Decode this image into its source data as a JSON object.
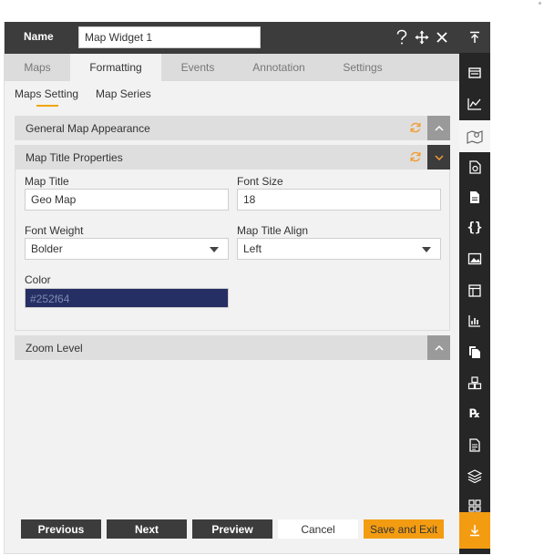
{
  "header": {
    "name_label": "Name",
    "name_value": "Map Widget 1",
    "help_icon": "question-icon",
    "move_icon": "move-icon",
    "close_icon": "close-icon"
  },
  "tabs": [
    {
      "label": "Maps"
    },
    {
      "label": "Formatting"
    },
    {
      "label": "Events"
    },
    {
      "label": "Annotation"
    },
    {
      "label": "Settings"
    }
  ],
  "active_tab": "Formatting",
  "subtabs": [
    {
      "label": "Maps Setting"
    },
    {
      "label": "Map Series"
    }
  ],
  "sections": {
    "general": {
      "title": "General Map Appearance"
    },
    "title_props": {
      "title": "Map Title Properties"
    },
    "zoom": {
      "title": "Zoom Level"
    }
  },
  "fields": {
    "map_title": {
      "label": "Map Title",
      "value": "Geo Map"
    },
    "font_size": {
      "label": "Font Size",
      "value": "18"
    },
    "font_weight": {
      "label": "Font Weight",
      "value": "Bolder"
    },
    "title_align": {
      "label": "Map Title Align",
      "value": "Left"
    },
    "color": {
      "label": "Color",
      "value": "#252f64"
    }
  },
  "footer": {
    "previous": "Previous",
    "next": "Next",
    "preview": "Preview",
    "cancel": "Cancel",
    "save_exit": "Save and Exit"
  },
  "colors": {
    "header_bg": "#3c3c3c",
    "accent": "#f39c12",
    "refresh": "#f39c34",
    "color_swatch": "#252f64"
  },
  "rail_icons": [
    "collapse-up-icon",
    "card-icon",
    "line-chart-icon",
    "map-icon",
    "document-chart-icon",
    "document-icon",
    "braces-icon",
    "image-icon",
    "layout-icon",
    "bar-chart-icon",
    "copy-icon",
    "cubes-icon",
    "rx-icon",
    "report-icon",
    "layers-icon",
    "grid-icon",
    "download-icon"
  ]
}
